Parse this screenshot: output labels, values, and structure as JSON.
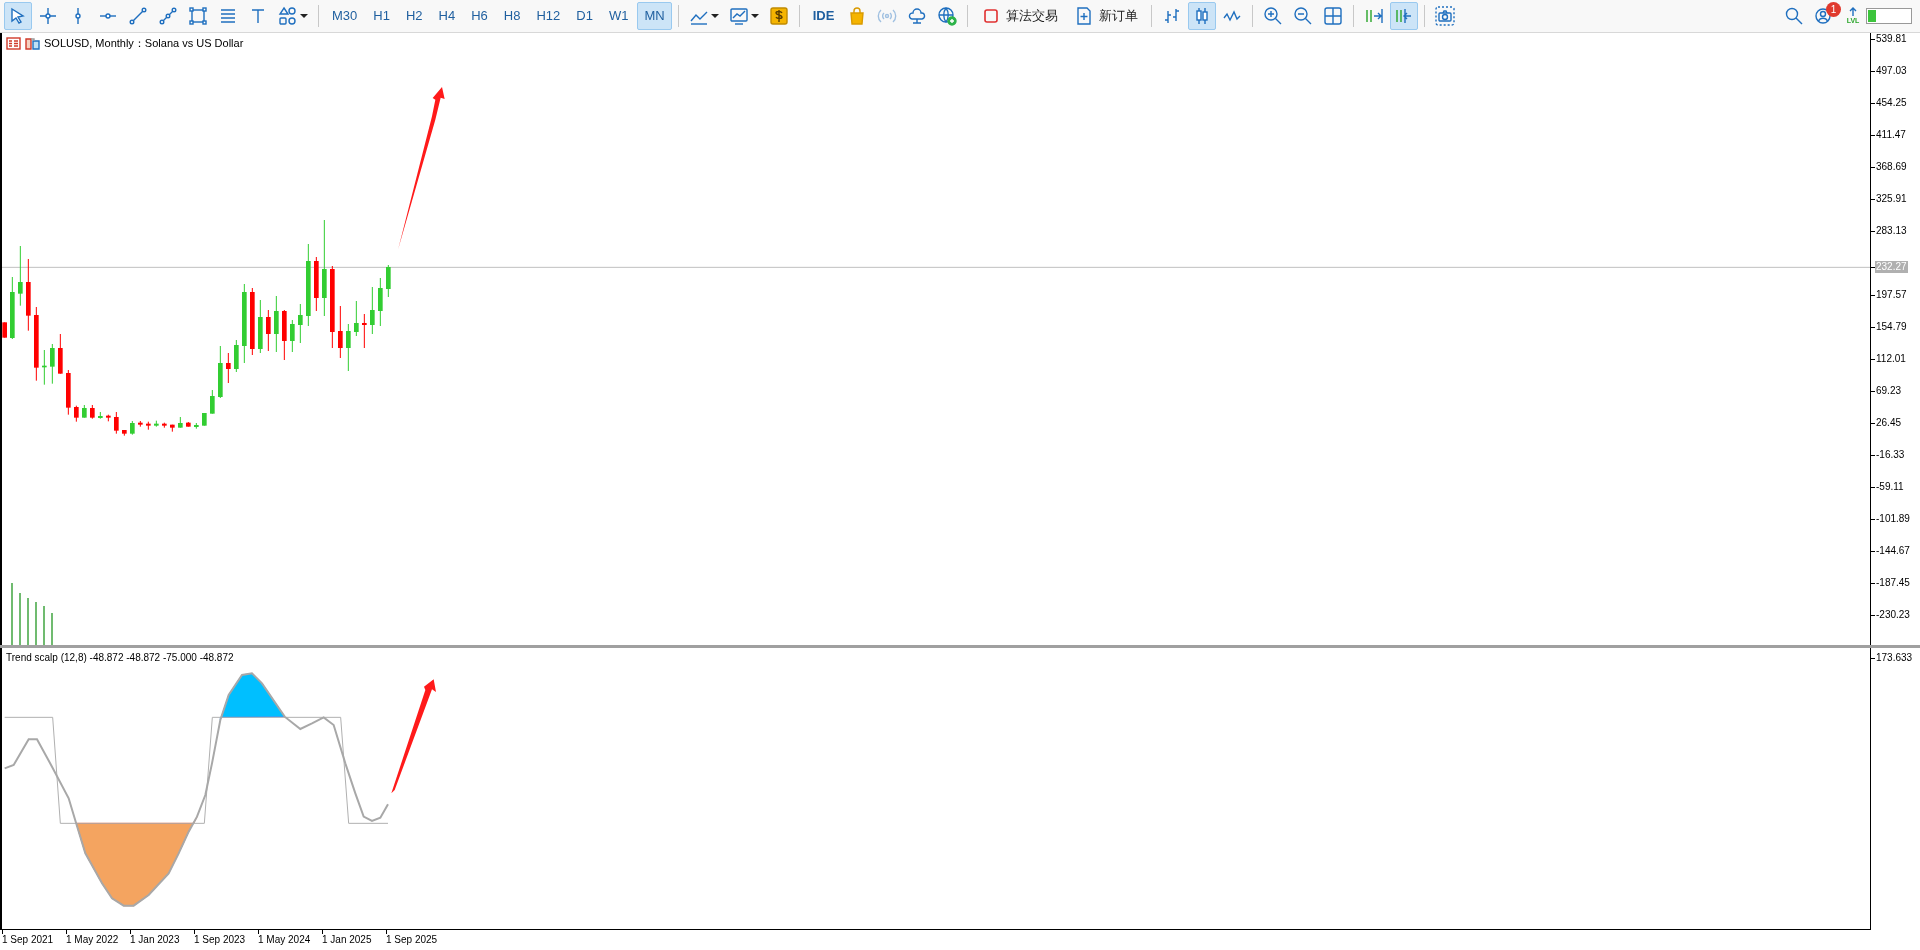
{
  "toolbar": {
    "drawing_tools": [
      {
        "selected": true,
        "dropdown": false
      },
      {
        "selected": false,
        "dropdown": false
      },
      {
        "selected": false,
        "dropdown": false
      },
      {
        "selected": false,
        "dropdown": false
      },
      {
        "selected": false,
        "dropdown": false
      },
      {
        "selected": false,
        "dropdown": false
      },
      {
        "selected": false,
        "dropdown": false
      },
      {
        "selected": false,
        "dropdown": false
      },
      {
        "selected": false,
        "dropdown": false
      },
      {
        "selected": false,
        "dropdown": true
      }
    ],
    "timeframes": [
      {
        "label": "M30",
        "selected": false
      },
      {
        "label": "H1",
        "selected": false
      },
      {
        "label": "H2",
        "selected": false
      },
      {
        "label": "H4",
        "selected": false
      },
      {
        "label": "H6",
        "selected": false
      },
      {
        "label": "H8",
        "selected": false
      },
      {
        "label": "H12",
        "selected": false
      },
      {
        "label": "D1",
        "selected": false
      },
      {
        "label": "W1",
        "selected": false
      },
      {
        "label": "MN",
        "selected": true
      }
    ],
    "chart_tools": [
      {
        "dropdown": true,
        "disabled": false
      },
      {
        "dropdown": true,
        "disabled": false
      },
      {
        "dropdown": false,
        "disabled": false
      }
    ],
    "service_tools": [
      {
        "label": "IDE",
        "disabled": false
      },
      {
        "disabled": false
      },
      {
        "disabled": true
      },
      {
        "disabled": false
      },
      {
        "disabled": false
      }
    ],
    "trade_buttons": [
      {
        "label": "算法交易"
      },
      {
        "label": "新订单"
      }
    ],
    "chart_types": [
      {
        "selected": false
      },
      {
        "selected": true
      },
      {
        "selected": false
      }
    ],
    "scroll_tools": [
      {
        "selected": false
      },
      {
        "selected": true
      }
    ],
    "notifications": {
      "count": "1"
    },
    "level_badge": {
      "label": "LVL"
    },
    "progress": {
      "level": 0.2
    }
  },
  "chart": {
    "title": "SOLUSD, Monthly：Solana vs US Dollar",
    "current_price": "232.27",
    "price_axis": [
      "539.81",
      "497.03",
      "454.25",
      "411.47",
      "368.69",
      "325.91",
      "283.13",
      "197.57",
      "154.79",
      "112.01",
      "69.23",
      "26.45",
      "-16.33",
      "-59.11",
      "-101.89",
      "-144.67",
      "-187.45",
      "-230.23"
    ]
  },
  "indicator": {
    "label": "Trend scalp (12,8) -48.872 -48.872 -75.000 -48.872",
    "axis": [
      "173.633"
    ]
  },
  "time_axis": [
    "1 Sep 2021",
    "1 May 2022",
    "1 Jan 2023",
    "1 Sep 2023",
    "1 May 2024",
    "1 Jan 2025",
    "1 Sep 2025"
  ]
}
